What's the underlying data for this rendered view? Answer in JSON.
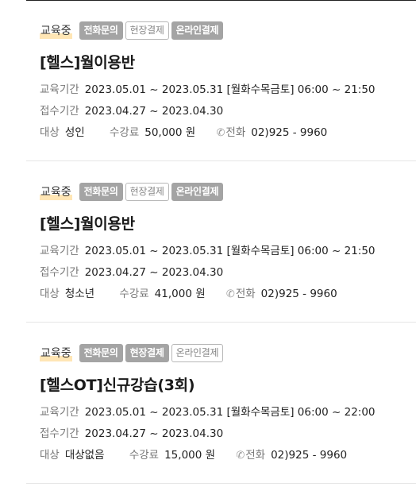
{
  "cards": [
    {
      "status": "교육중",
      "badges": [
        {
          "label": "전화문의",
          "active": true
        },
        {
          "label": "현장결제",
          "active": false
        },
        {
          "label": "온라인결제",
          "active": true
        }
      ],
      "title": "[헬스]월이용반",
      "edu_label": "교육기간",
      "edu_period": "2023.05.01 ~ 2023.05.31 [월화수목금토] 06:00 ~ 21:50",
      "reg_label": "접수기간",
      "reg_period": "2023.04.27 ~ 2023.04.30",
      "target_label": "대상",
      "target": "성인",
      "fee_label": "수강료",
      "fee": "50,000 원",
      "phone_label": "전화",
      "phone": "02)925 - 9960"
    },
    {
      "status": "교육중",
      "badges": [
        {
          "label": "전화문의",
          "active": true
        },
        {
          "label": "현장결제",
          "active": false
        },
        {
          "label": "온라인결제",
          "active": true
        }
      ],
      "title": "[헬스]월이용반",
      "edu_label": "교육기간",
      "edu_period": "2023.05.01 ~ 2023.05.31 [월화수목금토] 06:00 ~ 21:50",
      "reg_label": "접수기간",
      "reg_period": "2023.04.27 ~ 2023.04.30",
      "target_label": "대상",
      "target": "청소년",
      "fee_label": "수강료",
      "fee": "41,000 원",
      "phone_label": "전화",
      "phone": "02)925 - 9960"
    },
    {
      "status": "교육중",
      "badges": [
        {
          "label": "전화문의",
          "active": true
        },
        {
          "label": "현장결제",
          "active": true
        },
        {
          "label": "온라인결제",
          "active": false
        }
      ],
      "title": "[헬스OT]신규강습(3회)",
      "edu_label": "교육기간",
      "edu_period": "2023.05.01 ~ 2023.05.31 [월화수목금토] 06:00 ~ 22:00",
      "reg_label": "접수기간",
      "reg_period": "2023.04.27 ~ 2023.04.30",
      "target_label": "대상",
      "target": "대상없음",
      "fee_label": "수강료",
      "fee": "15,000 원",
      "phone_label": "전화",
      "phone": "02)925 - 9960"
    }
  ]
}
